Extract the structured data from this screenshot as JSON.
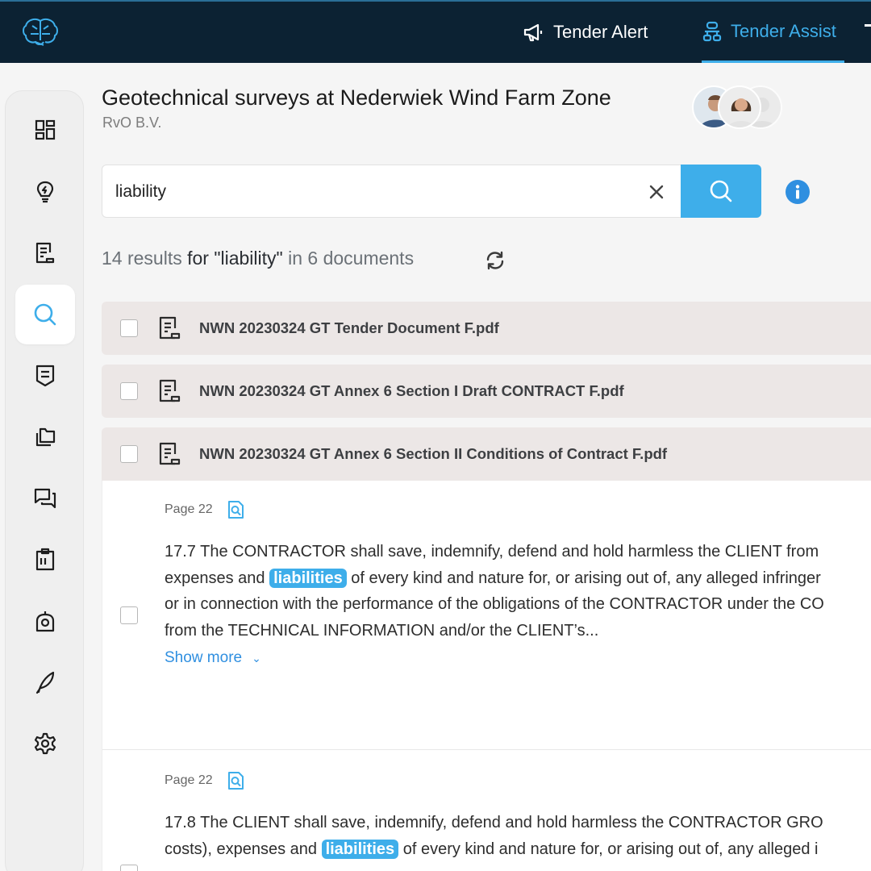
{
  "topbar": {
    "nav": [
      {
        "label": "Tender Alert",
        "icon": "megaphone-icon"
      },
      {
        "label": "Tender Assist",
        "icon": "assist-icon",
        "active": true
      }
    ]
  },
  "sidebar": {
    "items": [
      {
        "name": "dashboard",
        "icon": "dashboard-icon"
      },
      {
        "name": "insights",
        "icon": "lightbulb-icon"
      },
      {
        "name": "documents",
        "icon": "document-edit-icon"
      },
      {
        "name": "search",
        "icon": "search-icon",
        "active": true
      },
      {
        "name": "summary",
        "icon": "shield-list-icon"
      },
      {
        "name": "files",
        "icon": "files-icon"
      },
      {
        "name": "chat",
        "icon": "chat-icon"
      },
      {
        "name": "clipboard",
        "icon": "clipboard-icon"
      },
      {
        "name": "location",
        "icon": "map-pin-icon"
      },
      {
        "name": "writing",
        "icon": "feather-icon"
      },
      {
        "name": "settings",
        "icon": "gear-icon"
      }
    ]
  },
  "header": {
    "title": "Geotechnical surveys at Nederwiek Wind Farm Zone",
    "subtitle": "RvO B.V."
  },
  "search": {
    "value": "liability",
    "placeholder": ""
  },
  "summary": {
    "count": "14 results",
    "for": "for \"liability\"",
    "in": "in 6 documents"
  },
  "documents": [
    {
      "name": "NWN 20230324 GT Tender Document F.pdf"
    },
    {
      "name": "NWN 20230324 GT Annex 6 Section I Draft CONTRACT F.pdf"
    },
    {
      "name": "NWN 20230324 GT Annex 6 Section II Conditions of Contract F.pdf"
    }
  ],
  "hits": [
    {
      "page": "Page 22",
      "lines": [
        {
          "pre": "17.7 The CONTRACTOR shall save, indemnify, defend and hold harmless the CLIENT from",
          "hl": "",
          "post": ""
        },
        {
          "pre": "expenses and",
          "hl": "liabilities",
          "post": "of every kind and nature for, or arising out of, any alleged infringer"
        },
        {
          "pre": "or in connection with the performance of the obligations of the CONTRACTOR under the CO",
          "hl": "",
          "post": ""
        },
        {
          "pre": "from the TECHNICAL INFORMATION and/or the CLIENT’s...",
          "hl": "",
          "post": ""
        }
      ],
      "show_more": "Show more"
    },
    {
      "page": "Page 22",
      "lines": [
        {
          "pre": "17.8 The CLIENT shall save, indemnify, defend and hold harmless the CONTRACTOR GRO",
          "hl": "",
          "post": ""
        },
        {
          "pre": "costs), expenses and",
          "hl": "liabilities",
          "post": "of every kind and nature for, or arising out of, any alleged i"
        }
      ]
    }
  ],
  "colors": {
    "topbar": "#0c2233",
    "accent": "#3eaeea",
    "doc_row": "#ece7e6"
  }
}
